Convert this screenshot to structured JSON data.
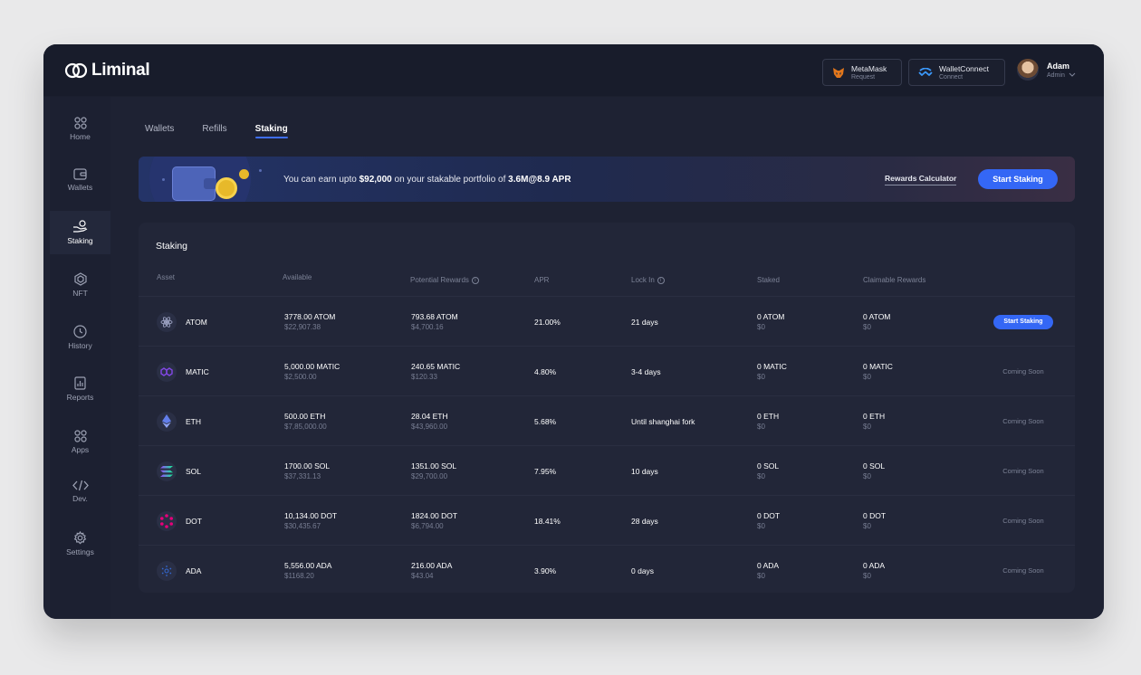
{
  "app": {
    "name": "Liminal"
  },
  "topbar": {
    "metamask": {
      "label": "MetaMask",
      "sub": "Request"
    },
    "walletconnect": {
      "label": "WalletConnect",
      "sub": "Connect"
    },
    "user": {
      "name": "Adam",
      "role": "Admin"
    }
  },
  "sidebar": {
    "items": [
      {
        "label": "Home",
        "icon": "home-grid-icon"
      },
      {
        "label": "Wallets",
        "icon": "wallet-icon"
      },
      {
        "label": "Staking",
        "icon": "staking-hand-icon",
        "active": true
      },
      {
        "label": "NFT",
        "icon": "hexagon-icon"
      },
      {
        "label": "History",
        "icon": "clock-icon"
      },
      {
        "label": "Reports",
        "icon": "report-icon"
      },
      {
        "label": "Apps",
        "icon": "apps-grid-icon"
      },
      {
        "label": "Dev.",
        "icon": "code-icon"
      },
      {
        "label": "Settings",
        "icon": "gear-icon"
      }
    ]
  },
  "tabs": [
    {
      "label": "Wallets"
    },
    {
      "label": "Refills"
    },
    {
      "label": "Staking",
      "active": true
    }
  ],
  "banner": {
    "text_pre": "You can earn upto ",
    "amount": "$92,000",
    "text_mid": " on your stakable portfolio of ",
    "portfolio": "3.6M@8.9 APR",
    "calculator_label": "Rewards Calculator",
    "start_label": "Start Staking"
  },
  "staking": {
    "title": "Staking",
    "columns": {
      "asset": "Asset",
      "available": "Available",
      "potential": "Potential Rewards",
      "apr": "APR",
      "lockin": "Lock In",
      "staked": "Staked",
      "claimable": "Claimable Rewards"
    },
    "rows": [
      {
        "asset": "ATOM",
        "available": "3778.00 ATOM",
        "available_usd": "$22,907.38",
        "potential": "793.68 ATOM",
        "potential_usd": "$4,700.16",
        "apr": "21.00%",
        "lockin": "21 days",
        "staked": "0 ATOM",
        "staked_usd": "$0",
        "claimable": "0 ATOM",
        "claimable_usd": "$0",
        "action": "Start Staking"
      },
      {
        "asset": "MATIC",
        "available": "5,000.00 MATIC",
        "available_usd": "$2,500.00",
        "potential": "240.65 MATIC",
        "potential_usd": "$120.33",
        "apr": "4.80%",
        "lockin": "3-4 days",
        "staked": "0 MATIC",
        "staked_usd": "$0",
        "claimable": "0 MATIC",
        "claimable_usd": "$0",
        "action": "Coming Soon"
      },
      {
        "asset": "ETH",
        "available": "500.00 ETH",
        "available_usd": "$7,85,000.00",
        "potential": "28.04 ETH",
        "potential_usd": "$43,960.00",
        "apr": "5.68%",
        "lockin": "Until shanghai fork",
        "staked": "0 ETH",
        "staked_usd": "$0",
        "claimable": "0 ETH",
        "claimable_usd": "$0",
        "action": "Coming Soon"
      },
      {
        "asset": "SOL",
        "available": "1700.00 SOL",
        "available_usd": "$37,331.13",
        "potential": "1351.00 SOL",
        "potential_usd": "$29,700.00",
        "apr": "7.95%",
        "lockin": "10 days",
        "staked": "0 SOL",
        "staked_usd": "$0",
        "claimable": "0 SOL",
        "claimable_usd": "$0",
        "action": "Coming Soon"
      },
      {
        "asset": "DOT",
        "available": "10,134.00 DOT",
        "available_usd": "$30,435.67",
        "potential": "1824.00 DOT",
        "potential_usd": "$6,794.00",
        "apr": "18.41%",
        "lockin": "28 days",
        "staked": "0 DOT",
        "staked_usd": "$0",
        "claimable": "0 DOT",
        "claimable_usd": "$0",
        "action": "Coming Soon"
      },
      {
        "asset": "ADA",
        "available": "5,556.00 ADA",
        "available_usd": "$1168.20",
        "potential": "216.00 ADA",
        "potential_usd": "$43.04",
        "apr": "3.90%",
        "lockin": "0 days",
        "staked": "0 ADA",
        "staked_usd": "$0",
        "claimable": "0 ADA",
        "claimable_usd": "$0",
        "action": "Coming Soon"
      }
    ]
  },
  "colors": {
    "accent": "#3467f5",
    "background": "#1e2233",
    "panel": "#222638"
  }
}
